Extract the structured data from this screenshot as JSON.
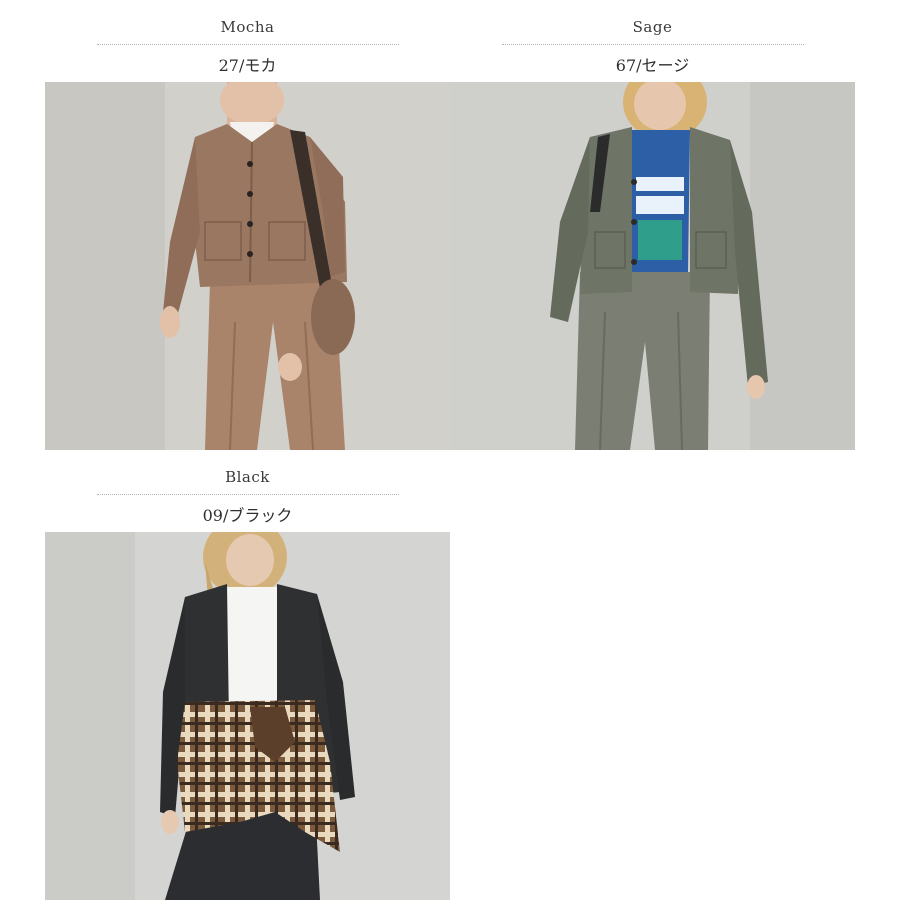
{
  "colors": [
    {
      "name": "Mocha",
      "code": "27/モカ",
      "jacket_color": "#9a7761",
      "pants_color": "#a9846b",
      "background": "#d2d0cb",
      "inner_color": "#f4f2ef"
    },
    {
      "name": "Sage",
      "code": "67/セージ",
      "jacket_color": "#6e7466",
      "pants_color": "#7b7f73",
      "background": "#cfcfcb",
      "inner_color": "#2d5fa6"
    },
    {
      "name": "Black",
      "code": "09/ブラック",
      "jacket_color": "#2f3032",
      "pants_color": "#2c2d30",
      "background": "#d4d4d2",
      "inner_color": "#f5f5f3",
      "tied_shirt_color": "#7c5a3c"
    }
  ]
}
